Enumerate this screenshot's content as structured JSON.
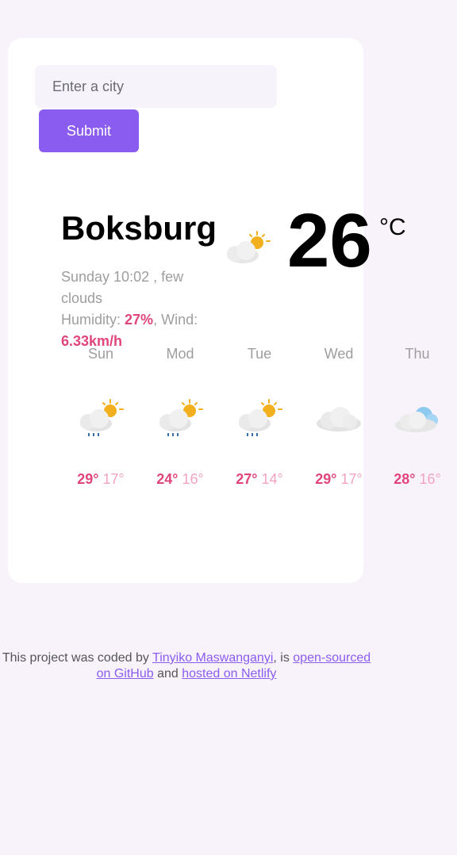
{
  "search": {
    "placeholder": "Enter a city",
    "submit_label": "Submit"
  },
  "current": {
    "city": "Boksburg",
    "datetime": "Sunday 10:02",
    "description": "few clouds",
    "humidity_label": "Humidity:",
    "humidity": "27%",
    "wind_label": "Wind:",
    "wind": "6.33km/h",
    "temperature": "26",
    "unit": "°C",
    "icon": "sun-behind-cloud-icon"
  },
  "forecast": [
    {
      "day": "Sun",
      "max": "29°",
      "min": "17°",
      "icon": "rain-sun-cloud-icon"
    },
    {
      "day": "Mod",
      "max": "24°",
      "min": "16°",
      "icon": "rain-sun-cloud-icon"
    },
    {
      "day": "Tue",
      "max": "27°",
      "min": "14°",
      "icon": "rain-sun-cloud-icon"
    },
    {
      "day": "Wed",
      "max": "29°",
      "min": "17°",
      "icon": "cloud-icon"
    },
    {
      "day": "Thu",
      "max": "28°",
      "min": "16°",
      "icon": "blue-cloud-icon"
    }
  ],
  "footer": {
    "text1": "This project was coded by",
    "author_link": "Tinyiko Maswanganyi",
    "text2": ", is",
    "github_link": "open-sourced on GitHub",
    "text3": "and",
    "netlify_link": "hosted on Netlify"
  },
  "colors": {
    "accent": "#8b5cf0",
    "pink": "#e0457b",
    "background": "#f8f3fb"
  }
}
